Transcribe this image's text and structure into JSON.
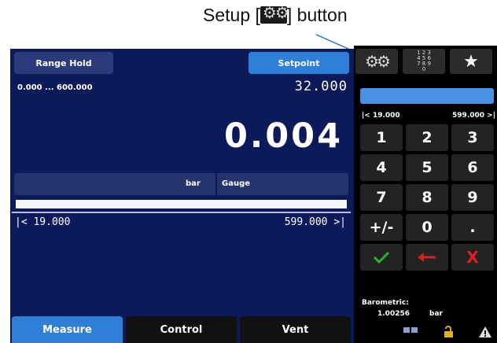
{
  "annotation": {
    "prefix": "Setup [",
    "suffix": "] button"
  },
  "screen": {
    "range_hold": "Range Hold",
    "setpoint_label": "Setpoint",
    "range_text": "0.000 ... 600.000",
    "setpoint_value": "32.000",
    "reading": "0.004",
    "unit": "bar",
    "mode": "Gauge",
    "limit_low": "|<  19.000",
    "limit_high": "599.000  >|",
    "tabs": [
      "Measure",
      "Control",
      "Vent"
    ]
  },
  "side": {
    "limit_low": "|< 19.000",
    "limit_high": "599.000 >|",
    "keys": [
      "1",
      "2",
      "3",
      "4",
      "5",
      "6",
      "7",
      "8",
      "9",
      "+/-",
      "0",
      "."
    ],
    "barometric_label": "Barometric:",
    "barometric_value": "1.00256",
    "barometric_unit": "bar"
  },
  "colors": {
    "screen_bg": "#0c1a5a",
    "accent": "#2f7fd6",
    "enter": "#2fae2f",
    "backspace": "#d42020",
    "clear": "#e02020"
  }
}
